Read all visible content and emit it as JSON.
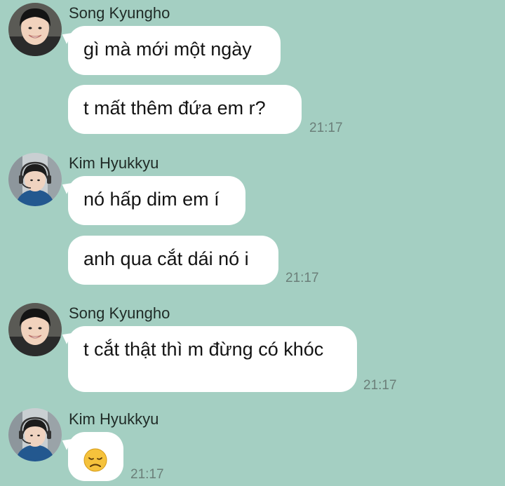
{
  "colors": {
    "background": "#a4cfc2",
    "bubble": "#ffffff",
    "timestamp": "#6b7f79"
  },
  "messages": [
    {
      "sender": "Song Kyungho",
      "avatar": "avatar-song-kyungho",
      "bubbles": [
        "gì mà mới một ngày",
        "t mất thêm đứa em r?"
      ],
      "time": "21:17"
    },
    {
      "sender": "Kim Hyukkyu",
      "avatar": "avatar-kim-hyukkyu",
      "bubbles": [
        "nó hấp dim em í",
        "anh qua cắt dái nó i"
      ],
      "time": "21:17"
    },
    {
      "sender": "Song Kyungho",
      "avatar": "avatar-song-kyungho",
      "bubbles": [
        "t cắt thật thì m đừng có khóc"
      ],
      "time": "21:17"
    },
    {
      "sender": "Kim Hyukkyu",
      "avatar": "avatar-kim-hyukkyu",
      "bubbles": [
        "😞"
      ],
      "time": "21:17"
    }
  ]
}
